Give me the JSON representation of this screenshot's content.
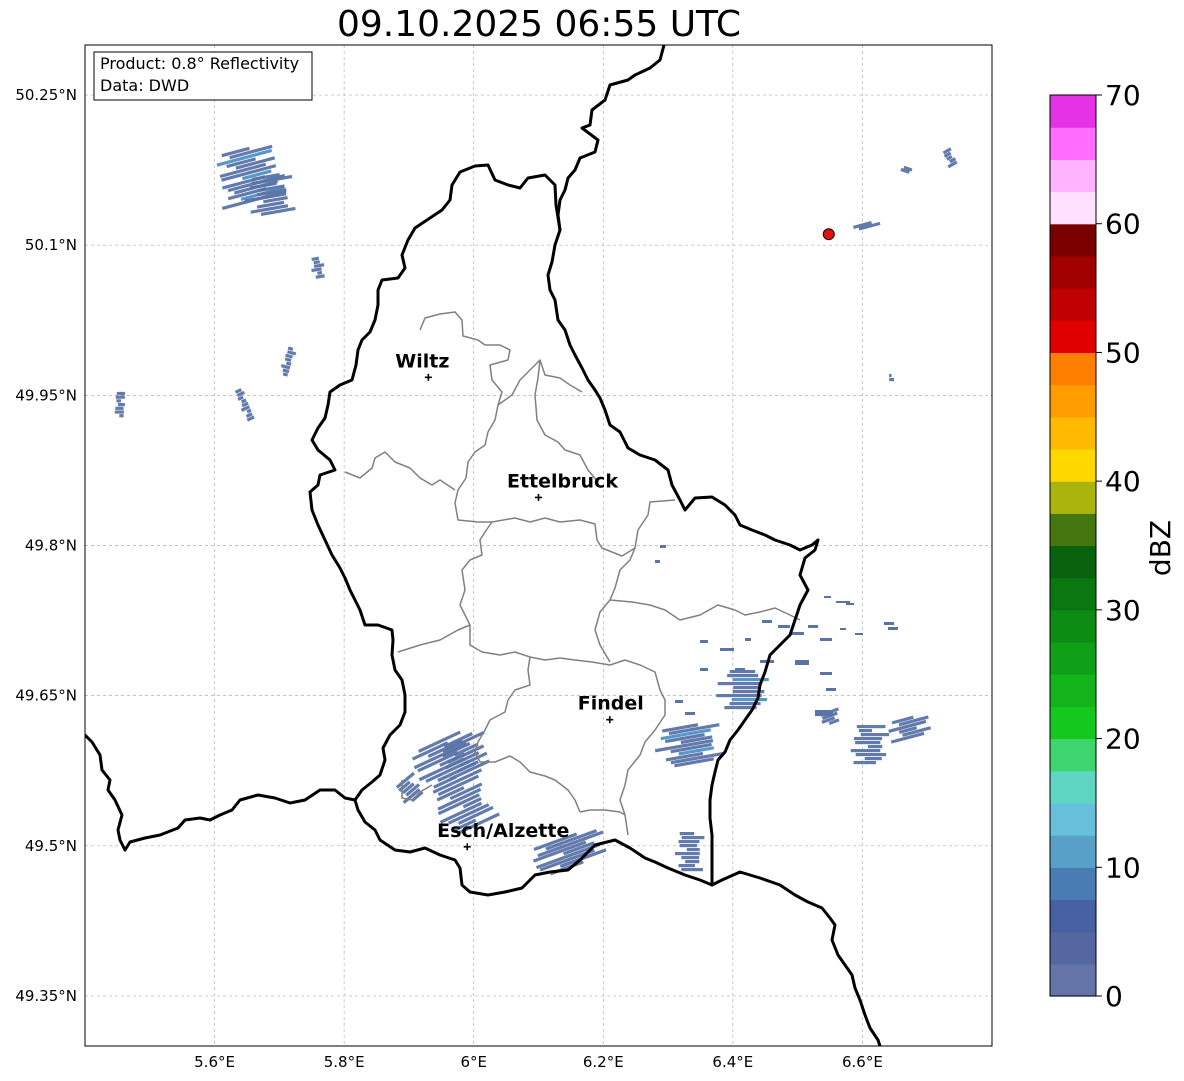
{
  "title": "09.10.2025 06:55 UTC",
  "info_box": {
    "line1": "Product: 0.8° Reflectivity",
    "line2": "Data: DWD"
  },
  "map_extent": {
    "lon": [
      5.4,
      6.8
    ],
    "lat": [
      49.3,
      50.3
    ]
  },
  "lat_ticks": [
    "50.25°N",
    "50.1°N",
    "49.95°N",
    "49.8°N",
    "49.65°N",
    "49.5°N",
    "49.35°N"
  ],
  "lon_ticks": [
    "5.6°E",
    "5.8°E",
    "6°E",
    "6.2°E",
    "6.4°E",
    "6.6°E"
  ],
  "lat_tick_values": [
    50.25,
    50.1,
    49.95,
    49.8,
    49.65,
    49.5,
    49.35
  ],
  "lon_tick_values": [
    5.6,
    5.8,
    6.0,
    6.2,
    6.4,
    6.6
  ],
  "cities": [
    {
      "name": "Wiltz",
      "lon": 5.93,
      "lat": 49.968
    },
    {
      "name": "Ettelbruck",
      "lon": 6.1,
      "lat": 49.848
    },
    {
      "name": "Findel",
      "lon": 6.21,
      "lat": 49.626
    },
    {
      "name": "Esch/Alzette",
      "lon": 5.99,
      "lat": 49.499
    }
  ],
  "radar_site": {
    "lon": 6.548,
    "lat": 50.111,
    "color": "#e31010"
  },
  "colorbar": {
    "label": "dBZ",
    "min": 0,
    "max": 70,
    "tick_labels": [
      "0",
      "10",
      "20",
      "30",
      "40",
      "50",
      "60",
      "70"
    ],
    "tick_values": [
      0,
      10,
      20,
      30,
      40,
      50,
      60,
      70
    ],
    "colors": [
      "#6474a8",
      "#5467a0",
      "#4660a2",
      "#4a7cb4",
      "#58a0c8",
      "#66c0dc",
      "#5fd6c2",
      "#3dd66e",
      "#14c81e",
      "#12b41a",
      "#10a018",
      "#0c8c12",
      "#0a7810",
      "#08620e",
      "#44780e",
      "#aab40a",
      "#ffd800",
      "#ffba00",
      "#ff9c00",
      "#ff7e00",
      "#e00000",
      "#c00000",
      "#a00000",
      "#7a0000",
      "#ffe0ff",
      "#ffb4ff",
      "#ff6eff",
      "#e632e6"
    ]
  },
  "echo_color": "#5a74a8",
  "echo_color_light": "#4d92c8"
}
